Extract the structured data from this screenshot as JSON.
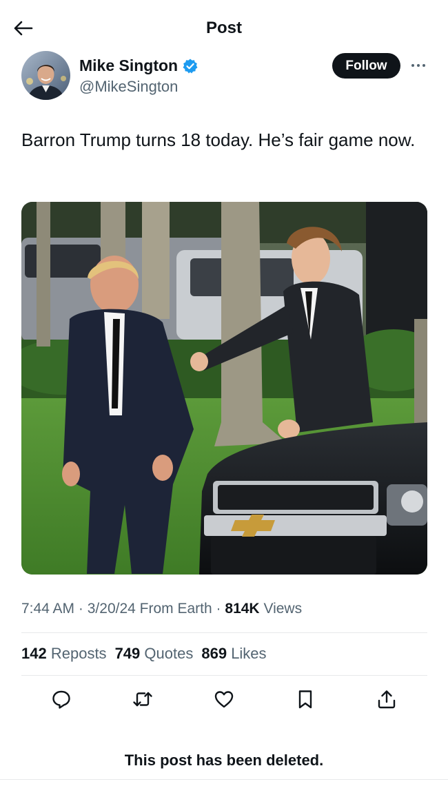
{
  "header": {
    "title": "Post",
    "back_icon": "arrow-left-icon"
  },
  "author": {
    "name": "Mike Sington",
    "handle": "@MikeSington",
    "verified_icon": "verified-badge-icon",
    "verified_color": "#1d9bf0"
  },
  "follow_label": "Follow",
  "more_icon": "more-horizontal-icon",
  "post": {
    "text": "Barron Trump turns 18 today. He’s fair game now."
  },
  "meta": {
    "time": "7:44 AM",
    "sep1": "·",
    "date": "3/20/24",
    "source": "From Earth",
    "sep2": "·",
    "views_count": "814K",
    "views_label": "Views"
  },
  "stats": [
    {
      "count": "142",
      "label": "Reposts"
    },
    {
      "count": "749",
      "label": "Quotes"
    },
    {
      "count": "869",
      "label": "Likes"
    }
  ],
  "actions": [
    "reply-icon",
    "repost-icon",
    "like-icon",
    "bookmark-icon",
    "share-icon"
  ],
  "deleted_notice": "This post has been deleted.",
  "colors": {
    "text": "#0f1419",
    "secondary": "#536471",
    "divider": "#e7e9ea",
    "accent": "#1d9bf0"
  }
}
